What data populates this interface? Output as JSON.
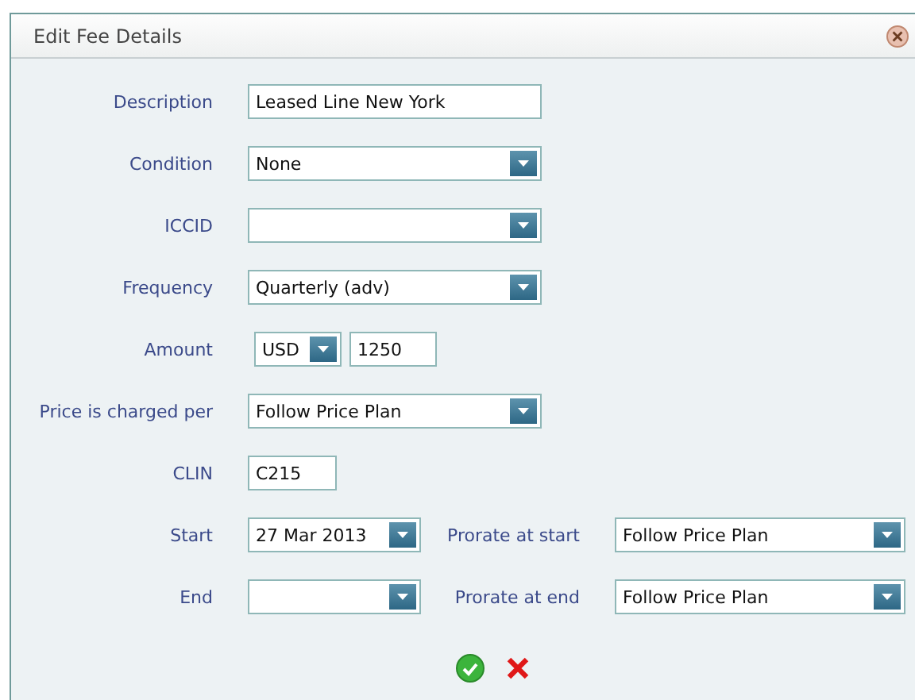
{
  "dialog": {
    "title": "Edit Fee Details"
  },
  "rows": [
    {
      "kind": "text",
      "label": "Description",
      "value": "Leased Line New York"
    },
    {
      "kind": "select",
      "label": "Condition",
      "value": "None"
    },
    {
      "kind": "select",
      "label": "ICCID",
      "value": ""
    },
    {
      "kind": "select",
      "label": "Frequency",
      "value": "Quarterly (adv)"
    },
    {
      "kind": "amount",
      "label": "Amount",
      "currency": "USD",
      "value": "1250"
    },
    {
      "kind": "select",
      "label": "Price is charged per",
      "value": "Follow Price Plan"
    },
    {
      "kind": "short-text",
      "label": "CLIN",
      "value": "C215"
    },
    {
      "kind": "pair",
      "label": "Start",
      "value": "27 Mar 2013",
      "second_label": "Prorate at start",
      "second_value": "Follow Price Plan"
    },
    {
      "kind": "pair",
      "label": "End",
      "value": "",
      "second_label": "Prorate at end",
      "second_value": "Follow Price Plan"
    }
  ]
}
